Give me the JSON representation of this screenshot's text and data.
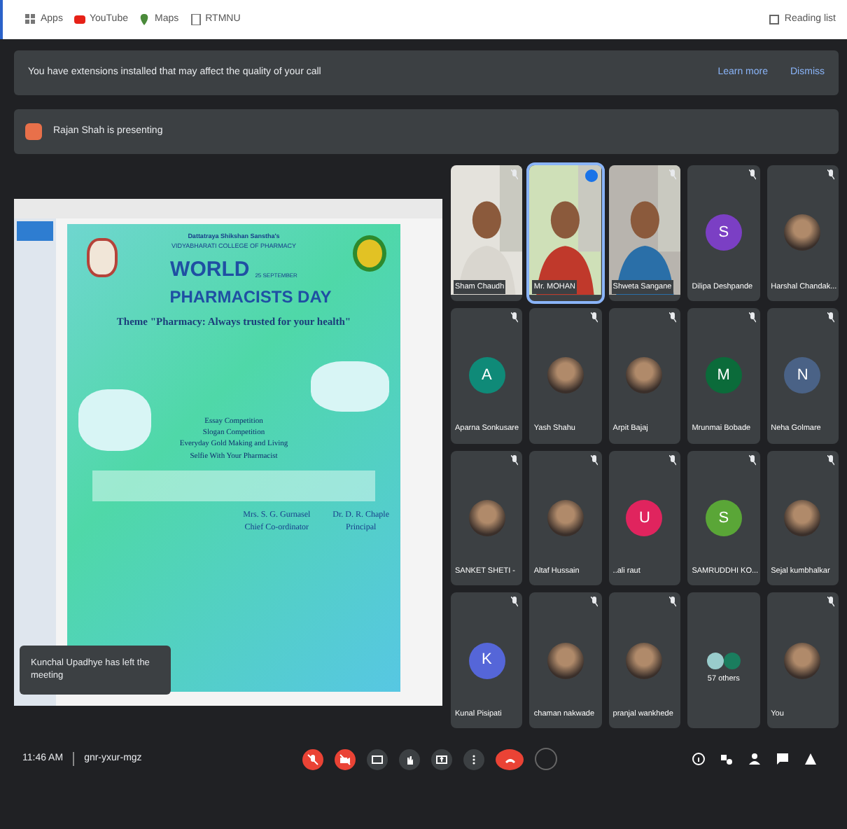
{
  "bookmarks": [
    {
      "label": "Apps",
      "kind": "grid"
    },
    {
      "label": "YouTube",
      "kind": "youtube"
    },
    {
      "label": "Maps",
      "kind": "maps"
    },
    {
      "label": "RTMNU",
      "kind": "page"
    }
  ],
  "reading_list": "Reading list",
  "banner": {
    "text": "You have extensions installed that may affect the quality of your call",
    "links": [
      "Learn more",
      "Dismiss"
    ]
  },
  "presenting": {
    "text": "Rajan Shah is presenting"
  },
  "slide": {
    "institute": "Dattatraya Shikshan Sanstha's",
    "college": "VIDYABHARATI COLLEGE OF PHARMACY",
    "title_1": "WORLD",
    "date": "25 SEPTEMBER",
    "title_2": "PHARMACISTS DAY",
    "theme": "Theme \"Pharmacy: Always trusted for your health\"",
    "activities": [
      "Essay Competition",
      "Slogan Competition",
      "Everyday Gold Making and Living",
      "Selfie With Your Pharmacist"
    ],
    "signatures": [
      {
        "name": "Mrs. S. G. Gurnasel",
        "role": "Chief Co-ordinator"
      },
      {
        "name": "Dr. D. R. Chaple",
        "role": "Principal"
      }
    ]
  },
  "toast": "Kunchal Upadhye has left the meeting",
  "tiles": [
    {
      "name": "Sham Chaudh",
      "kind": "video",
      "speaking": false
    },
    {
      "name": "Mr. MOHAN",
      "kind": "video",
      "speaking": true
    },
    {
      "name": "Shweta Sangane",
      "kind": "video",
      "speaking": false
    },
    {
      "name": "Dilipa Deshpande",
      "kind": "avatar",
      "letter": "S",
      "color": "#7b3fc4",
      "speaking": false
    },
    {
      "name": "Harshal Chandak...",
      "speaking": false
    },
    {
      "name": "Aparna Sonkusare",
      "kind": "avatar",
      "letter": "A",
      "color": "#0f8a78",
      "speaking": false
    },
    {
      "name": "Yash Shahu",
      "speaking": false
    },
    {
      "name": "Arpit Bajaj",
      "speaking": false
    },
    {
      "name": "Mrunmai Bobade",
      "kind": "avatar",
      "letter": "M",
      "color": "#0b6b3a",
      "speaking": false
    },
    {
      "name": "Neha Golmare",
      "kind": "avatar",
      "letter": "N",
      "color": "#4a6286",
      "speaking": false
    },
    {
      "name": "SANKET SHETI -",
      "speaking": false
    },
    {
      "name": "Altaf Hussain",
      "speaking": false
    },
    {
      "name": "..ali raut",
      "kind": "avatar",
      "letter": "U",
      "color": "#e0245e",
      "speaking": false
    },
    {
      "name": "SAMRUDDHI KO...",
      "kind": "avatar",
      "letter": "S",
      "color": "#5aa637",
      "speaking": false
    },
    {
      "name": "Sejal kumbhalkar",
      "speaking": false
    },
    {
      "name": "Kunal Pisipati",
      "kind": "avatar",
      "letter": "K",
      "color": "#5566d8",
      "speaking": false
    },
    {
      "name": "chaman nakwade",
      "speaking": false
    },
    {
      "name": "pranjal wankhede",
      "speaking": false
    },
    {
      "name": "57 others",
      "kind": "others",
      "speaking": false
    },
    {
      "name": "You",
      "speaking": false
    }
  ],
  "footer": {
    "time": "11:46 AM",
    "code": "gnr-yxur-mgz"
  },
  "controls": [
    {
      "kind": "mic",
      "off": true
    },
    {
      "kind": "cam",
      "off": true
    },
    {
      "kind": "captions",
      "off": false
    },
    {
      "kind": "hand",
      "off": false
    },
    {
      "kind": "present",
      "off": false
    },
    {
      "kind": "more",
      "off": false
    },
    {
      "kind": "end"
    }
  ],
  "side_controls": [
    {
      "kind": "info"
    },
    {
      "kind": "tools"
    },
    {
      "kind": "people"
    },
    {
      "kind": "chat"
    },
    {
      "kind": "activities"
    }
  ]
}
